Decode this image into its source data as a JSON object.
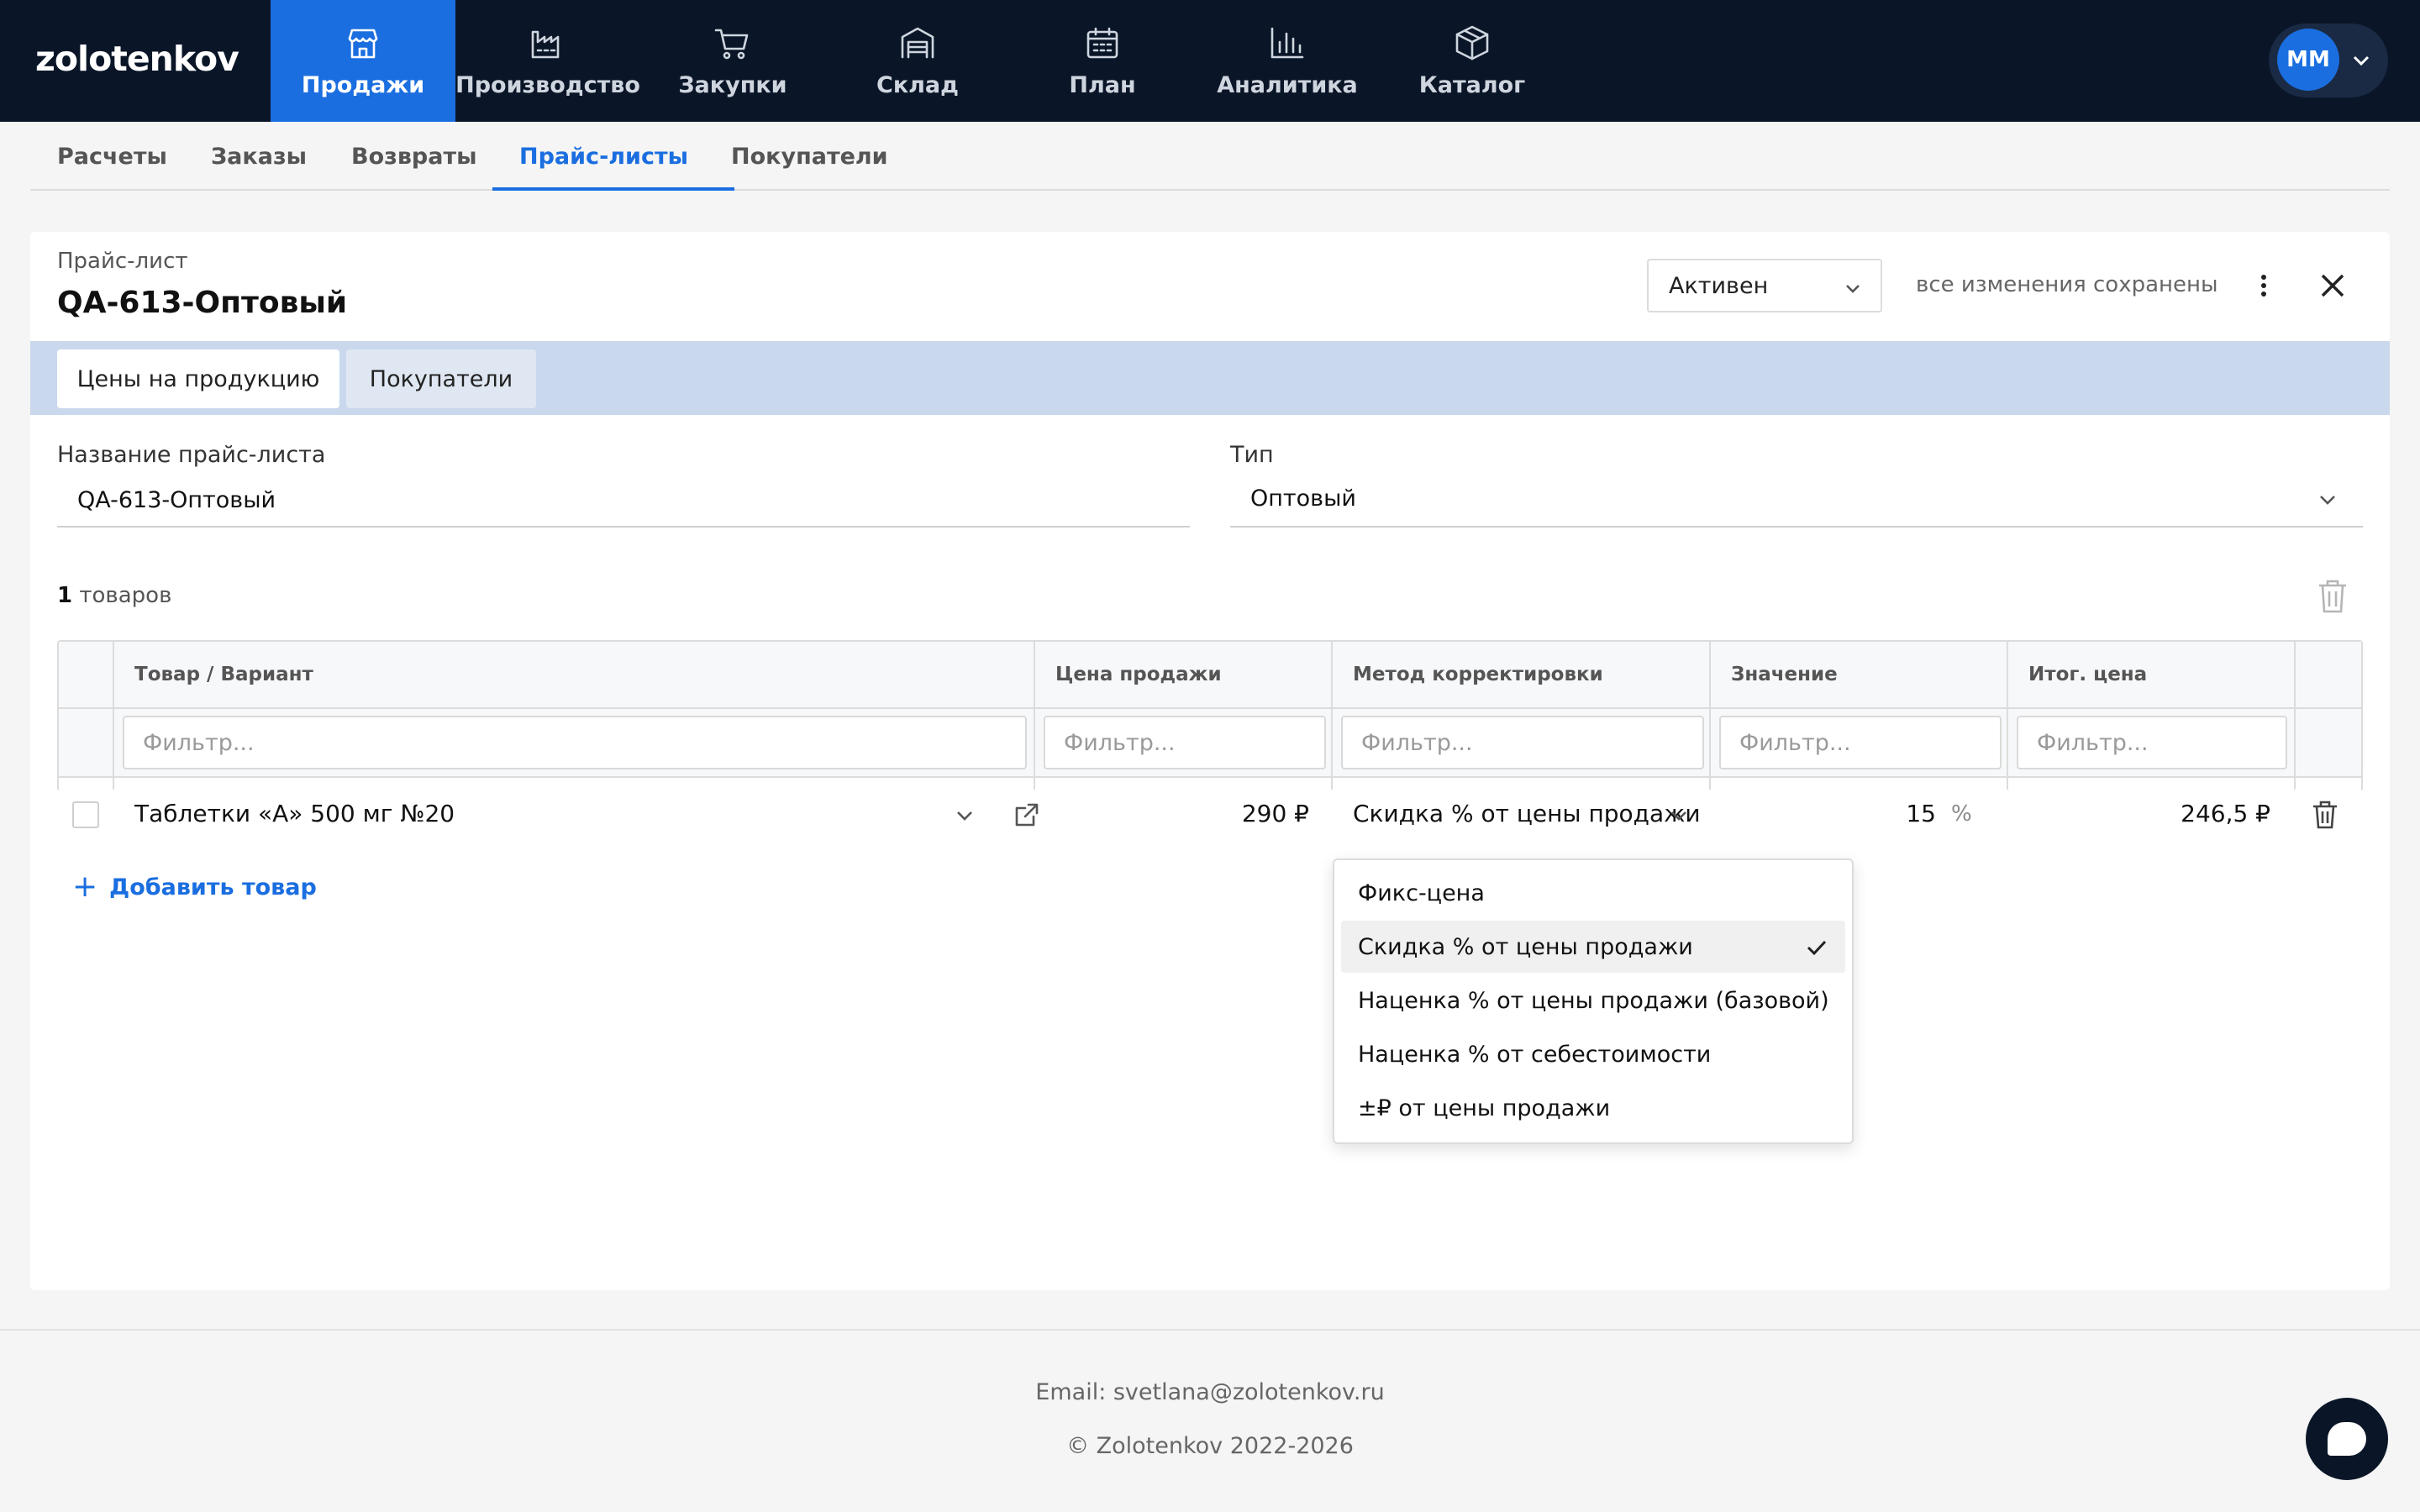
{
  "brand": {
    "logo": "zolotenkov"
  },
  "nav": {
    "items": [
      {
        "label": "Продажи",
        "icon": "store-icon"
      },
      {
        "label": "Производство",
        "icon": "factory-icon"
      },
      {
        "label": "Закупки",
        "icon": "cart-icon"
      },
      {
        "label": "Склад",
        "icon": "warehouse-icon"
      },
      {
        "label": "План",
        "icon": "calendar-icon"
      },
      {
        "label": "Аналитика",
        "icon": "bar-chart-icon"
      },
      {
        "label": "Каталог",
        "icon": "box-icon"
      }
    ],
    "active": "Продажи",
    "user_initials": "ММ"
  },
  "subtabs": {
    "items": [
      "Расчеты",
      "Заказы",
      "Возвраты",
      "Прайс-листы",
      "Покупатели"
    ],
    "active": "Прайс-листы"
  },
  "card": {
    "subtitle": "Прайс-лист",
    "title": "QA-613-Оптовый",
    "status": "Активен",
    "saved_text": "все изменения сохранены",
    "tabs": [
      "Цены на продукцию",
      "Покупатели"
    ],
    "active_tab": "Цены на продукцию"
  },
  "form": {
    "name_label": "Название прайс-листа",
    "name_value": "QA-613-Оптовый",
    "type_label": "Тип",
    "type_value": "Оптовый"
  },
  "products": {
    "count": "1",
    "count_suffix": "товаров",
    "columns": [
      "Товар / Вариант",
      "Цена продажи",
      "Метод корректировки",
      "Значение",
      "Итог. цена"
    ],
    "filter_placeholder": "Фильтр...",
    "rows": [
      {
        "product": "Таблетки «А» 500 мг №20",
        "sale_price": "290 ₽",
        "method": "Скидка % от цены продажи",
        "value": "15",
        "value_unit": "%",
        "final_price": "246,5 ₽"
      }
    ],
    "add_label": "Добавить товар"
  },
  "method_dropdown": {
    "options": [
      "Фикс-цена",
      "Скидка % от цены продажи",
      "Наценка % от цены продажи (базовой)",
      "Наценка % от себестоимости",
      "±₽ от цены продажи"
    ],
    "selected": "Скидка % от цены продажи"
  },
  "footer": {
    "email": "Email: svetlana@zolotenkov.ru",
    "copyright": "© Zolotenkov 2022-2026"
  },
  "colors": {
    "topbar": "#0a1628",
    "accent": "#1a6ee0",
    "tab_strip": "#c9d8ec"
  }
}
